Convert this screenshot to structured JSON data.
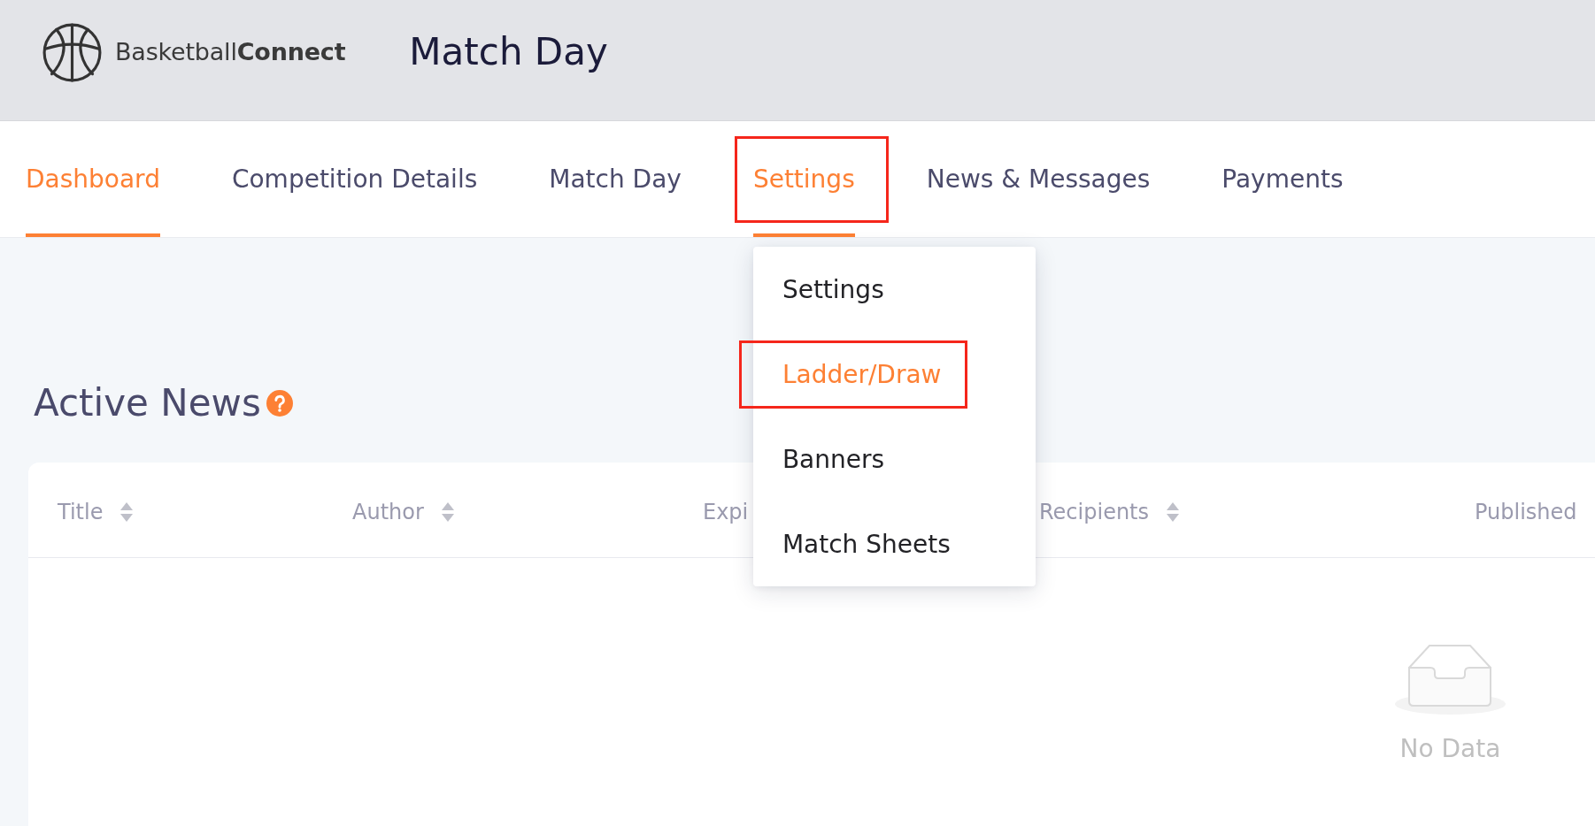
{
  "header": {
    "brand": "Basketball**Connect**",
    "title": "Match Day"
  },
  "nav": {
    "tabs": [
      {
        "label": "Dashboard",
        "selected": true,
        "highlighted": false
      },
      {
        "label": "Competition Details",
        "selected": false,
        "highlighted": false
      },
      {
        "label": "Match Day",
        "selected": false,
        "highlighted": false
      },
      {
        "label": "Settings",
        "selected": true,
        "highlighted": true,
        "menu": [
          {
            "label": "Settings",
            "selected": false,
            "highlighted": false
          },
          {
            "label": "Ladder/Draw",
            "selected": true,
            "highlighted": true
          },
          {
            "label": "Banners",
            "selected": false,
            "highlighted": false
          },
          {
            "label": "Match Sheets",
            "selected": false,
            "highlighted": false
          }
        ]
      },
      {
        "label": "News & Messages",
        "selected": false,
        "highlighted": false
      },
      {
        "label": "Payments",
        "selected": false,
        "highlighted": false
      }
    ]
  },
  "section": {
    "title": "Active News"
  },
  "table": {
    "columns": [
      {
        "label": "Title",
        "sortable": true
      },
      {
        "label": "Author",
        "sortable": true
      },
      {
        "label": "Expi",
        "sortable": false
      },
      {
        "label": "Recipients",
        "sortable": true
      },
      {
        "label": "Published",
        "sortable": false
      }
    ],
    "empty_text": "No Data"
  }
}
